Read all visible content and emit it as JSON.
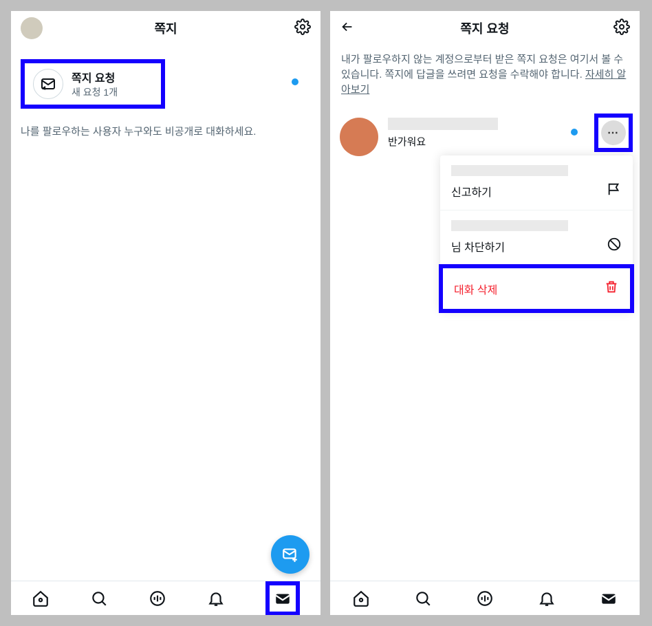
{
  "left": {
    "header": {
      "title": "쪽지"
    },
    "request_card": {
      "title": "쪽지 요청",
      "subtitle": "새 요청 1개"
    },
    "hint": "나를 팔로우하는 사용자 누구와도 비공개로 대화하세요."
  },
  "right": {
    "header": {
      "title": "쪽지 요청"
    },
    "description": "내가 팔로우하지 않는 계정으로부터 받은 쪽지 요청은 여기서 볼 수 있습니다. 쪽지에 답글을 쓰려면 요청을 수락해야 합니다. ",
    "learn_more": "자세히 알아보기",
    "message": {
      "preview": "반가워요"
    },
    "popup": {
      "report": "신고하기",
      "block_suffix": "님 차단하기",
      "delete": "대화 삭제"
    }
  }
}
